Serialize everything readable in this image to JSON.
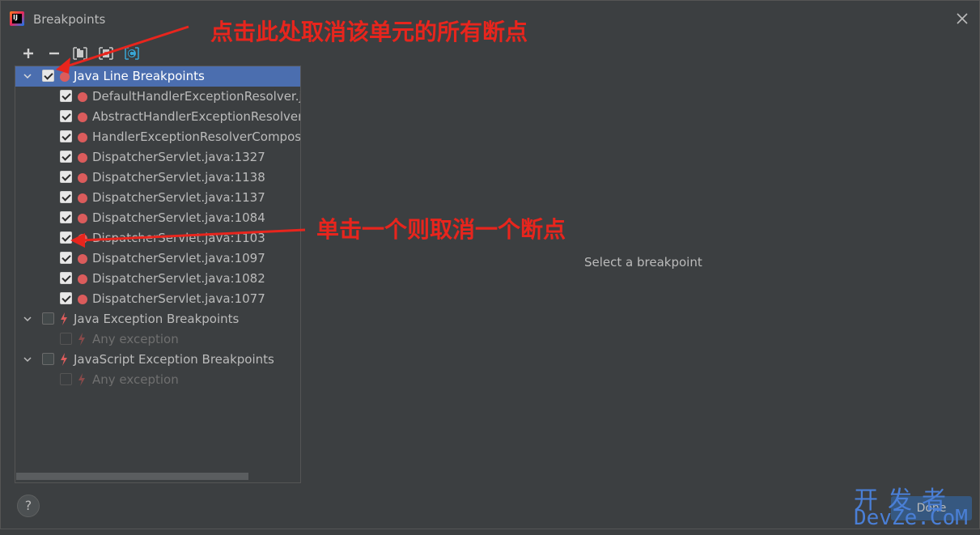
{
  "window": {
    "title": "Breakpoints",
    "app_icon_letters": "IJ"
  },
  "toolbar": {
    "add_icon": "plus-icon",
    "remove_icon": "minus-icon",
    "group_by_package_icon": "group-by-package-icon",
    "group_by_file_icon": "group-by-file-icon",
    "group_by_class_icon": "group-by-class-icon"
  },
  "tree": {
    "groups": [
      {
        "label": "Java Line Breakpoints",
        "checked": true,
        "icon": "red-dot-icon",
        "items": [
          "DefaultHandlerExceptionResolver.ja",
          "AbstractHandlerExceptionResolver.",
          "HandlerExceptionResolverComposi",
          "DispatcherServlet.java:1327",
          "DispatcherServlet.java:1138",
          "DispatcherServlet.java:1137",
          "DispatcherServlet.java:1084",
          "DispatcherServlet.java:1103",
          "DispatcherServlet.java:1097",
          "DispatcherServlet.java:1082",
          "DispatcherServlet.java:1077"
        ]
      },
      {
        "label": "Java Exception Breakpoints",
        "checked": false,
        "icon": "lightning-icon",
        "items": [
          "Any exception"
        ]
      },
      {
        "label": "JavaScript Exception Breakpoints",
        "checked": false,
        "icon": "lightning-icon",
        "items": [
          "Any exception"
        ]
      }
    ]
  },
  "details": {
    "placeholder": "Select a breakpoint"
  },
  "footer": {
    "help_label": "?",
    "done_label": "Done"
  },
  "annotations": {
    "top": "点击此处取消该单元的所有断点",
    "middle": "单击一个则取消一个断点"
  },
  "watermark": {
    "top": "开发者",
    "bottom": "DevZe.CoM"
  },
  "colors": {
    "background": "#3c3f41",
    "selection": "#4b6eaf",
    "breakpoint_red": "#db5c5c",
    "annotation_red": "#e8251d",
    "watermark_blue": "#4a7fd6"
  }
}
